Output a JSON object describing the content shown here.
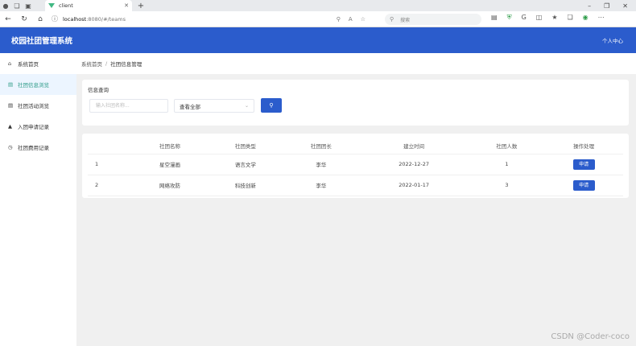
{
  "browser": {
    "tab_title": "client",
    "url_host": "localhost",
    "url_path": ":8080/#/teams",
    "search_placeholder": "搜索"
  },
  "app": {
    "title": "校园社团管理系统",
    "user_center": "个人中心"
  },
  "sidebar": {
    "items": [
      {
        "label": "系统首页",
        "icon": "home-icon"
      },
      {
        "label": "社团信息浏览",
        "icon": "folder-icon"
      },
      {
        "label": "社团活动浏览",
        "icon": "document-icon"
      },
      {
        "label": "入团申请记录",
        "icon": "inbox-icon"
      },
      {
        "label": "社团费用记录",
        "icon": "clock-icon"
      }
    ]
  },
  "breadcrumb": {
    "home": "系统首页",
    "separator": "/",
    "current": "社团信息管理"
  },
  "query": {
    "title": "信息查询",
    "name_placeholder": "输入社团名称...",
    "type_select": "查看全部"
  },
  "table": {
    "headers": [
      "",
      "社团名称",
      "社团类型",
      "社团团长",
      "建立时间",
      "社团人数",
      "操作处理"
    ],
    "rows": [
      {
        "index": "1",
        "name": "星空漫画",
        "type": "语言文学",
        "leader": "李华",
        "created": "2022-12-27",
        "members": "1",
        "action": "申请"
      },
      {
        "index": "2",
        "name": "网络攻防",
        "type": "科技创新",
        "leader": "李华",
        "created": "2022-01-17",
        "members": "3",
        "action": "申请"
      }
    ]
  },
  "watermark": "CSDN @Coder-coco"
}
